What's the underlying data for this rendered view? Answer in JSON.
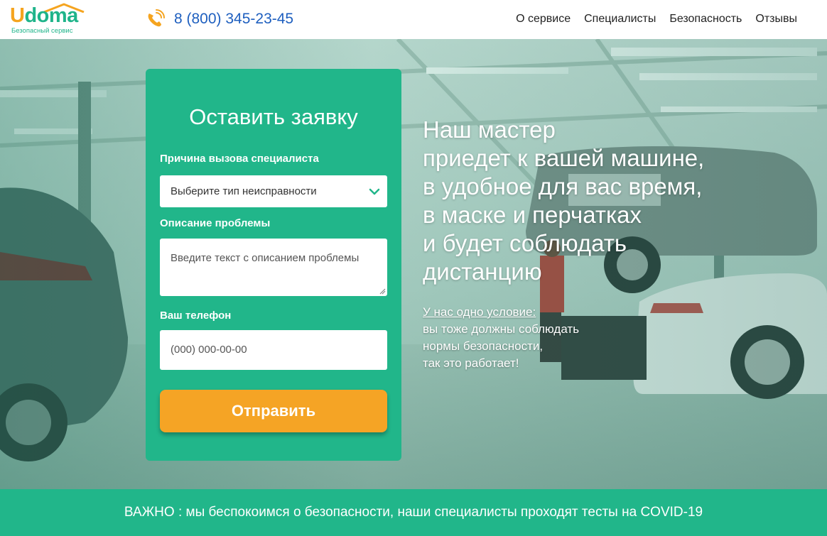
{
  "header": {
    "logo": {
      "u": "U",
      "rest": "doma",
      "tagline": "Безопасный сервис"
    },
    "phone_icon": "phone-ringing-icon",
    "phone": "8 (800) 345-23-45",
    "nav": [
      {
        "label": "О сервисе"
      },
      {
        "label": "Специалисты"
      },
      {
        "label": "Безопасность"
      },
      {
        "label": "Отзывы"
      }
    ]
  },
  "form": {
    "title": "Оставить заявку",
    "reason_label": "Причина вызова специалиста",
    "reason_value": "Выберите тип неисправности",
    "description_label": "Описание проблемы",
    "description_placeholder": "Введите текст с описанием проблемы",
    "phone_label": "Ваш телефон",
    "phone_placeholder": "(000) 000-00-00",
    "submit_label": "Отправить"
  },
  "hero": {
    "headline": [
      "Наш мастер",
      "приедет к вашей машине,",
      "в удобное для вас время,",
      "в маске и перчатках",
      "и будет соблюдать",
      "дистанцию"
    ],
    "condition_title": "У нас одно условие:",
    "condition_lines": [
      "вы тоже должны соблюдать",
      "нормы безопасности,",
      "так это работает!"
    ]
  },
  "banner": {
    "text": "ВАЖНО : мы беспокоимся о безопасности, наши специалисты проходят тесты на COVID-19"
  },
  "colors": {
    "brand_green": "#21b68a",
    "accent_orange": "#f5a425",
    "phone_blue": "#1e5fbf"
  }
}
